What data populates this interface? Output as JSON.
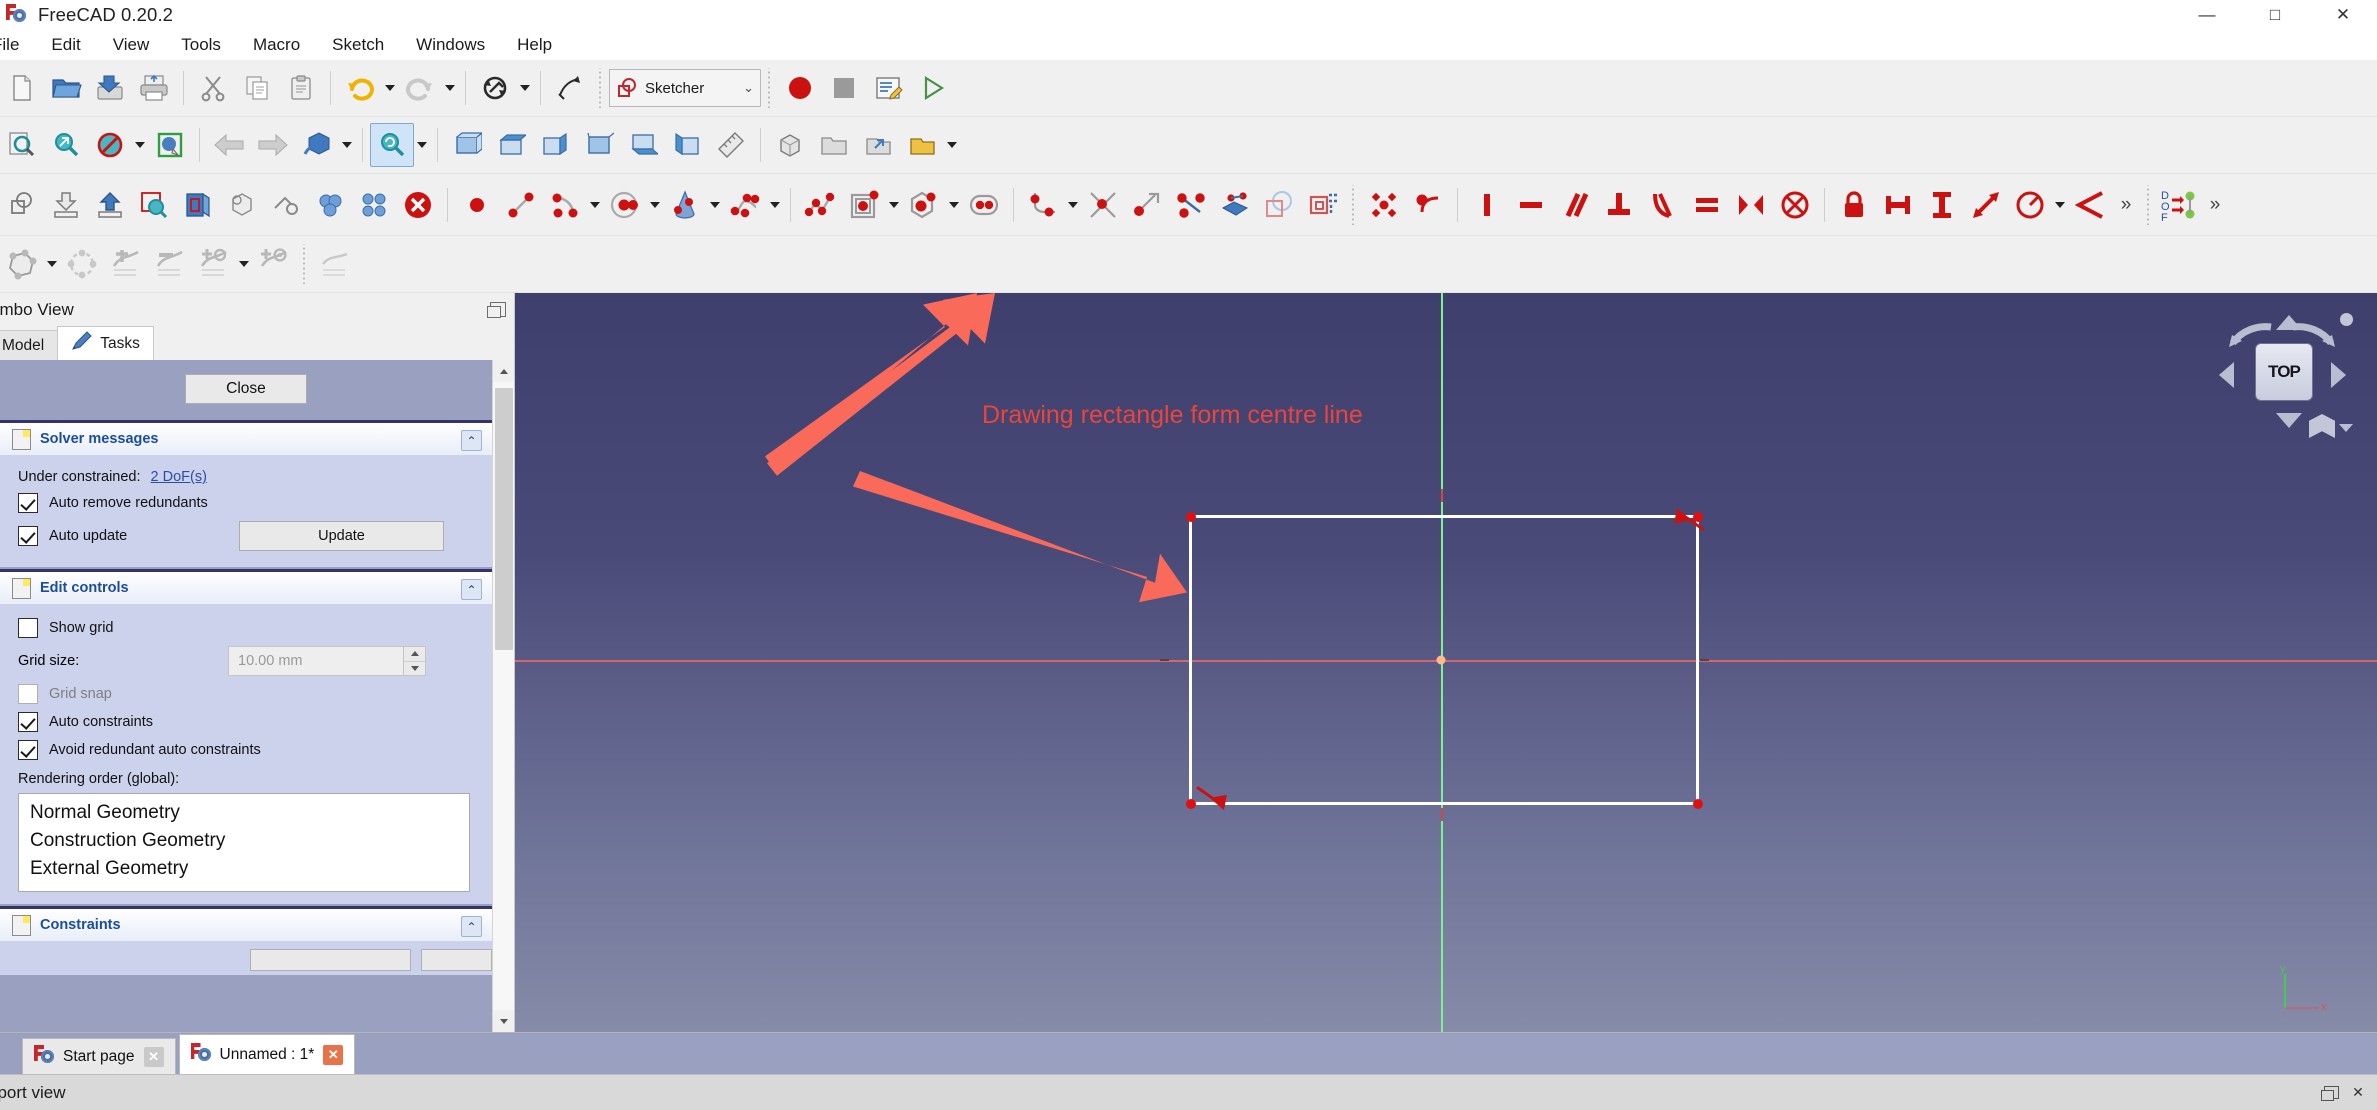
{
  "window": {
    "title": "FreeCAD 0.20.2",
    "app_icon": "freecad-logo-icon",
    "minimize": "—",
    "maximize": "□",
    "close": "✕"
  },
  "menubar": {
    "items": [
      {
        "label": "File"
      },
      {
        "label": "Edit"
      },
      {
        "label": "View"
      },
      {
        "label": "Tools"
      },
      {
        "label": "Macro"
      },
      {
        "label": "Sketch"
      },
      {
        "label": "Windows"
      },
      {
        "label": "Help"
      }
    ]
  },
  "workbench": {
    "selected": "Sketcher",
    "chevron": "⌄"
  },
  "toolbars": {
    "file": [
      {
        "name": "new-document-icon",
        "tip": "New"
      },
      {
        "name": "open-document-icon",
        "tip": "Open"
      },
      {
        "name": "save-document-icon",
        "tip": "Save"
      },
      {
        "name": "print-document-icon",
        "tip": "Print"
      },
      {
        "name": "cut-icon",
        "tip": "Cut"
      },
      {
        "name": "copy-icon",
        "tip": "Copy"
      },
      {
        "name": "paste-icon",
        "tip": "Paste"
      },
      {
        "name": "undo-icon",
        "tip": "Undo"
      },
      {
        "name": "redo-icon",
        "tip": "Redo"
      },
      {
        "name": "refresh-icon",
        "tip": "Refresh"
      },
      {
        "name": "whats-this-icon",
        "tip": "What's this?"
      }
    ],
    "macro": [
      {
        "name": "macro-record-icon",
        "tip": "Macro recording"
      },
      {
        "name": "macro-stop-icon",
        "tip": "Stop macro recording"
      },
      {
        "name": "macro-edit-icon",
        "tip": "Macros"
      },
      {
        "name": "macro-execute-icon",
        "tip": "Execute macro"
      }
    ],
    "view": [
      {
        "name": "fit-all-icon",
        "tip": "Fit all"
      },
      {
        "name": "fit-selection-icon",
        "tip": "Fit selection"
      },
      {
        "name": "draw-style-icon",
        "tip": "Draw style"
      },
      {
        "name": "axonometric-icon",
        "tip": "Axonometric"
      },
      {
        "name": "back-icon",
        "tip": "Back"
      },
      {
        "name": "forward-icon",
        "tip": "Forward"
      },
      {
        "name": "iso-view-icon",
        "tip": "Isometric"
      },
      {
        "name": "sync-view-icon",
        "tip": "Sync view"
      },
      {
        "name": "front-view-icon",
        "tip": "Front"
      },
      {
        "name": "top-view-icon",
        "tip": "Top"
      },
      {
        "name": "right-view-icon",
        "tip": "Right"
      },
      {
        "name": "rear-view-icon",
        "tip": "Rear"
      },
      {
        "name": "bottom-view-icon",
        "tip": "Bottom"
      },
      {
        "name": "left-view-icon",
        "tip": "Left"
      },
      {
        "name": "measure-icon",
        "tip": "Measure"
      },
      {
        "name": "part-box-icon",
        "tip": "Part box"
      },
      {
        "name": "create-group-icon",
        "tip": "Create group"
      },
      {
        "name": "link-icon",
        "tip": "Make link"
      },
      {
        "name": "link-actions-icon",
        "tip": "Link actions"
      }
    ],
    "sketcher_edit": [
      {
        "name": "create-sketch-icon",
        "tip": "Create sketch"
      },
      {
        "name": "import-sketch-icon",
        "tip": "Import sketch"
      },
      {
        "name": "export-sketch-icon",
        "tip": "Export sketch"
      },
      {
        "name": "view-sketch-icon",
        "tip": "View sketch"
      },
      {
        "name": "view-section-icon",
        "tip": "View section"
      },
      {
        "name": "map-sketch-icon",
        "tip": "Map sketch to face"
      },
      {
        "name": "reorient-sketch-icon",
        "tip": "Reorient sketch"
      },
      {
        "name": "validate-sketch-icon",
        "tip": "Validate sketch"
      },
      {
        "name": "merge-sketches-icon",
        "tip": "Merge sketches"
      },
      {
        "name": "stop-operation-icon",
        "tip": "Leave sketch"
      }
    ],
    "sketcher_geometry": [
      {
        "name": "create-point-icon",
        "tip": "Create point"
      },
      {
        "name": "create-line-icon",
        "tip": "Create line"
      },
      {
        "name": "create-arc-icon",
        "tip": "Create arc"
      },
      {
        "name": "create-circle-icon",
        "tip": "Create circle"
      },
      {
        "name": "create-conic-icon",
        "tip": "Create conic"
      },
      {
        "name": "create-bspline-icon",
        "tip": "Create B-spline"
      },
      {
        "name": "create-polyline-icon",
        "tip": "Create polyline"
      },
      {
        "name": "create-rectangle-icon",
        "tip": "Create rectangle"
      },
      {
        "name": "create-polygon-icon",
        "tip": "Create regular polygon"
      },
      {
        "name": "create-slot-icon",
        "tip": "Create slot"
      },
      {
        "name": "create-fillet-icon",
        "tip": "Create fillet"
      },
      {
        "name": "trim-edge-icon",
        "tip": "Trim edge"
      },
      {
        "name": "extend-edge-icon",
        "tip": "Extend edge"
      },
      {
        "name": "split-edge-icon",
        "tip": "Split edge"
      },
      {
        "name": "external-geometry-icon",
        "tip": "External geometry"
      },
      {
        "name": "carbon-copy-icon",
        "tip": "Carbon copy"
      },
      {
        "name": "toggle-construction-icon",
        "tip": "Toggle construction geometry"
      }
    ],
    "sketcher_constraints": [
      {
        "name": "constrain-coincident-icon",
        "tip": "Coincident"
      },
      {
        "name": "constrain-point-on-object-icon",
        "tip": "Point on object"
      },
      {
        "name": "constrain-vertical-icon",
        "tip": "Vertical"
      },
      {
        "name": "constrain-horizontal-icon",
        "tip": "Horizontal"
      },
      {
        "name": "constrain-parallel-icon",
        "tip": "Parallel"
      },
      {
        "name": "constrain-perpendicular-icon",
        "tip": "Perpendicular"
      },
      {
        "name": "constrain-tangent-icon",
        "tip": "Tangent"
      },
      {
        "name": "constrain-equal-icon",
        "tip": "Equal"
      },
      {
        "name": "constrain-symmetric-icon",
        "tip": "Symmetric"
      },
      {
        "name": "constrain-block-icon",
        "tip": "Block"
      },
      {
        "name": "constrain-lock-icon",
        "tip": "Lock"
      },
      {
        "name": "constrain-distance-x-icon",
        "tip": "Horizontal distance"
      },
      {
        "name": "constrain-distance-y-icon",
        "tip": "Vertical distance"
      },
      {
        "name": "constrain-distance-icon",
        "tip": "Distance"
      },
      {
        "name": "constrain-radius-icon",
        "tip": "Radius"
      },
      {
        "name": "constrain-angle-icon",
        "tip": "Angle"
      }
    ],
    "sketcher_tools": [
      {
        "name": "sketcher-visual-icon",
        "tip": "Sketcher visual"
      },
      {
        "name": "sketcher-clone-icon",
        "tip": "Clone"
      },
      {
        "name": "sketcher-symmetry-icon",
        "tip": "Symmetry"
      },
      {
        "name": "sketcher-remove-axes-icon",
        "tip": "Remove axes alignment"
      },
      {
        "name": "sketcher-rect-array-icon",
        "tip": "Rectangular array"
      },
      {
        "name": "sketcher-select-icon",
        "tip": "Select elements"
      },
      {
        "name": "sketcher-validate-icon",
        "tip": "Validate"
      }
    ],
    "dof_badge": {
      "name": "dof-indicator-icon",
      "label_top": "D",
      "label_mid": "O",
      "label_bot": "F"
    },
    "overflow": "»"
  },
  "combo_view": {
    "title": "ombo View",
    "tabs": [
      {
        "label": "Model",
        "selected": false,
        "icon": "model-tree-icon"
      },
      {
        "label": "Tasks",
        "selected": true,
        "icon": "pencil-icon"
      }
    ],
    "close_button": "Close",
    "solver": {
      "title": "Solver messages",
      "status_label": "Under constrained:",
      "status_value": "2 DoF(s)",
      "auto_remove_redundants": {
        "label": "Auto remove redundants",
        "checked": true
      },
      "auto_update": {
        "label": "Auto update",
        "checked": true
      },
      "update_button": "Update",
      "collapse": "⌃"
    },
    "edit_controls": {
      "title": "Edit controls",
      "show_grid": {
        "label": "Show grid",
        "checked": false
      },
      "grid_size_label": "Grid size:",
      "grid_size_value": "10.00 mm",
      "grid_snap": {
        "label": "Grid snap",
        "checked": false,
        "disabled": true
      },
      "auto_constraints": {
        "label": "Auto constraints",
        "checked": true
      },
      "avoid_redundant": {
        "label": "Avoid redundant auto constraints",
        "checked": true
      },
      "rendering_order_label": "Rendering order (global):",
      "rendering_order": [
        "Normal Geometry",
        "Construction Geometry",
        "External Geometry"
      ],
      "collapse": "⌃"
    },
    "constraints": {
      "title": "Constraints",
      "collapse": "⌃"
    }
  },
  "viewport": {
    "annotation": "Drawing rectangle form centre line",
    "navcube": {
      "face_label": "TOP"
    },
    "colors": {
      "x_axis": "#e86a6a",
      "y_axis": "#7ef08e",
      "geometry_edge": "#ffffff",
      "vertex": "#e01010",
      "origin": "#ffb98a",
      "annotation": "#e8453c"
    }
  },
  "document_tabs": [
    {
      "label": "Start page",
      "selected": false,
      "close": "✕"
    },
    {
      "label": "Unnamed : 1*",
      "selected": true,
      "close": "✕"
    }
  ],
  "report_view": {
    "title": "eport view",
    "float": "float-icon",
    "close": "✕"
  }
}
